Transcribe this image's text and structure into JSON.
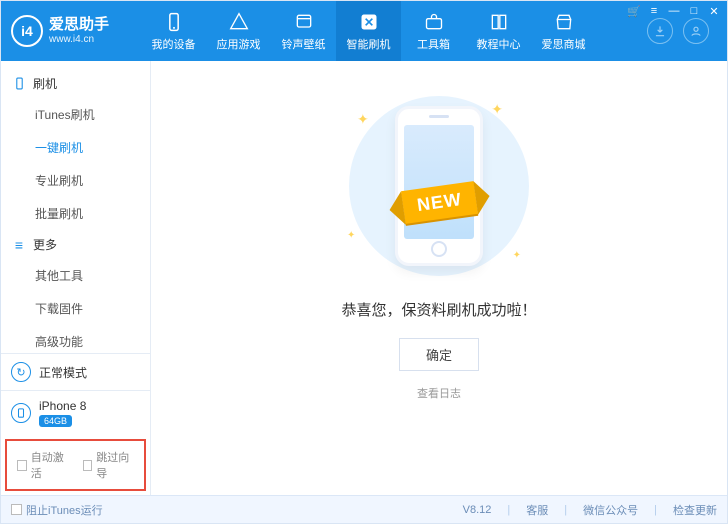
{
  "app": {
    "name_cn": "爱思助手",
    "name_en": "www.i4.cn",
    "logo_letters": "i4"
  },
  "sysbtns": {
    "cart": "🛒",
    "menu": "≡",
    "min": "—",
    "max": "□",
    "close": "✕"
  },
  "tabs": [
    {
      "label": "我的设备"
    },
    {
      "label": "应用游戏"
    },
    {
      "label": "铃声壁纸"
    },
    {
      "label": "智能刷机",
      "active": true
    },
    {
      "label": "工具箱"
    },
    {
      "label": "教程中心"
    },
    {
      "label": "爱思商城"
    }
  ],
  "sidebar": {
    "g1_title": "刷机",
    "g1_items": [
      {
        "label": "iTunes刷机"
      },
      {
        "label": "一键刷机",
        "active": true
      },
      {
        "label": "专业刷机"
      },
      {
        "label": "批量刷机"
      }
    ],
    "g2_title": "更多",
    "g2_items": [
      {
        "label": "其他工具"
      },
      {
        "label": "下载固件"
      },
      {
        "label": "高级功能"
      }
    ],
    "mode": {
      "label": "正常模式"
    },
    "device": {
      "name": "iPhone 8",
      "storage": "64GB"
    },
    "checks": [
      {
        "label": "自动激活"
      },
      {
        "label": "跳过向导"
      }
    ]
  },
  "main": {
    "ribbon": "NEW",
    "message": "恭喜您，保资料刷机成功啦！",
    "ok": "确定",
    "log_link": "查看日志"
  },
  "footer": {
    "chk_stop_itunes": "阻止iTunes运行",
    "version": "V8.12",
    "kefu": "客服",
    "wechat": "微信公众号",
    "update": "检查更新"
  }
}
